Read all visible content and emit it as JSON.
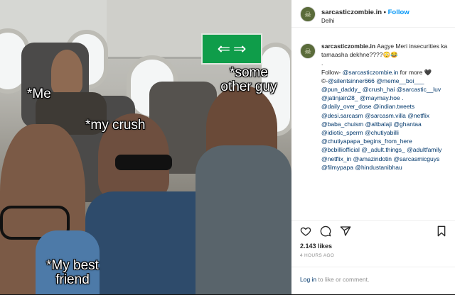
{
  "post": {
    "username": "sarcasticzombie.in",
    "separator": "•",
    "follow_label": "Follow",
    "location": "Delhi",
    "avatar_letter": "☠"
  },
  "photo": {
    "exit_sign_left": "⇐",
    "exit_sign_right": "⇒",
    "captions": {
      "other_guy": "*some\nother guy",
      "me": "*Me",
      "my_crush": "*my crush",
      "best_friend": "*My best\nfriend"
    }
  },
  "caption": {
    "username": "sarcasticzombie.in",
    "line1": "Aagye Meri insecurities ka tamaasha dekhne????😳😂",
    "dot": ".",
    "follow_prefix": "Follow- ",
    "follow_handle": "@sarcasticzombie.in",
    "follow_suffix": " for more 🖤",
    "credits_prefix": "©-",
    "tags": [
      "@silentsinner666",
      "@meme__boi___",
      "@pun_daddy_",
      "@crush_hai",
      "@sarcastic__luv",
      "@jatinjain28_",
      "@maymay.hoe",
      ". @daily_over_dose",
      "@indian.tweets",
      "@desi.sarcasm",
      "@sarcasm.villa",
      "@netflix",
      "@baba_chuism",
      "@altbalaji",
      "@ghantaa",
      "@idiotic_sperm",
      "@chutiyabilli",
      "@chutiyapapa_begins_from_here",
      "@bcbilliofficial",
      "@_adult.things_",
      "@adultfamily",
      "@netflix_in",
      "@amazindotin",
      "@sarcasmicguys",
      "@filmypapa",
      "@hindustanibhau"
    ]
  },
  "actions": {
    "like_icon": "heart-icon",
    "comment_icon": "comment-icon",
    "share_icon": "share-icon",
    "save_icon": "bookmark-icon"
  },
  "stats": {
    "likes": "2.143 likes",
    "time": "4 HOURS AGO"
  },
  "footer": {
    "login_link": "Log in",
    "login_rest": " to like or comment."
  }
}
